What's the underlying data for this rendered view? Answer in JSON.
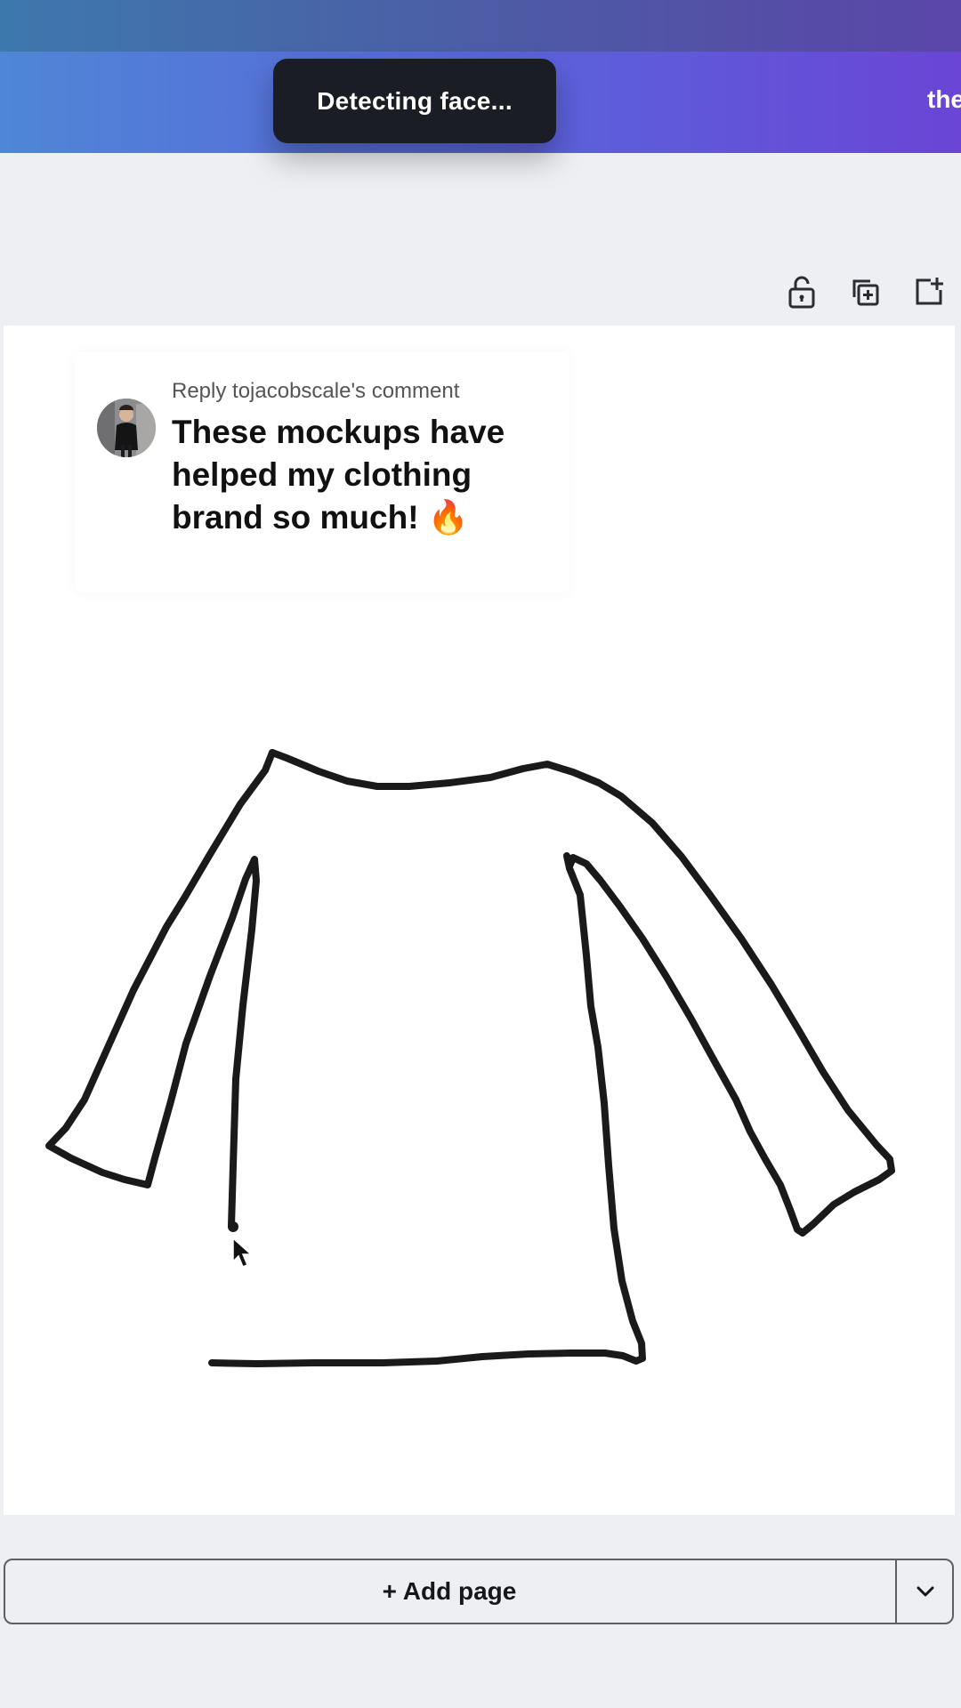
{
  "header": {
    "partial_text": "the"
  },
  "toast": {
    "message": "Detecting face..."
  },
  "page_toolbar": {
    "icons": [
      "lock-open-icon",
      "duplicate-page-icon",
      "add-page-icon"
    ]
  },
  "comment": {
    "reply_prefix": "Reply to",
    "reply_user": "jacobscale",
    "reply_suffix": "'s comment",
    "text": "These mockups have helped my clothing brand so much! 🔥"
  },
  "footer": {
    "add_page_label": "+ Add page",
    "dropdown_icon": "chevron-down-icon"
  },
  "colors": {
    "header_gradient_start": "#4f86d6",
    "header_gradient_end": "#6a45d6",
    "toast_bg": "#1b1d25",
    "canvas_bg": "#ffffff",
    "stroke": "#1a1a1a"
  }
}
